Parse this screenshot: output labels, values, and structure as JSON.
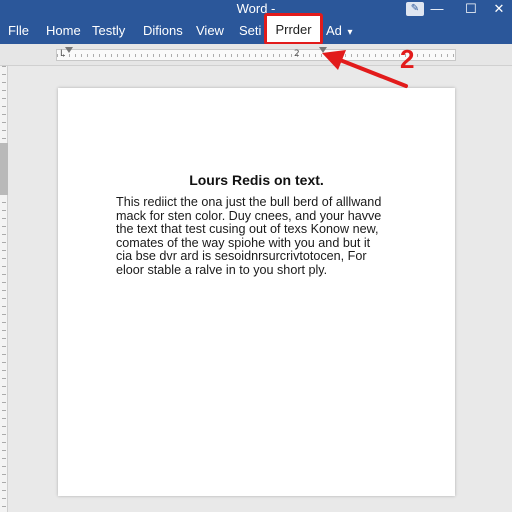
{
  "window": {
    "app_title": "Word -",
    "minimize_glyph": "—",
    "maximize_glyph": "☐",
    "close_glyph": "✕",
    "quick_icon": "pen-icon"
  },
  "ribbon": {
    "tabs": [
      {
        "label": "Flle"
      },
      {
        "label": "Home"
      },
      {
        "label": "Testly"
      },
      {
        "label": "Difions"
      },
      {
        "label": "View"
      },
      {
        "label": "Seti"
      },
      {
        "label": "Prrder"
      },
      {
        "label": "Ad"
      }
    ],
    "highlighted_tab_index": 6,
    "ad_dropdown_glyph": "▾"
  },
  "ruler": {
    "markers": [
      "L",
      "2"
    ]
  },
  "document": {
    "heading": "Lours Redis on text.",
    "body_lines": [
      "This rediict the ona just the bull berd of alllwand",
      "mack for sten color. Duy cnees, and your havve",
      "the text that test cusing out of texs Konow new,",
      "comates of the way spiohe with you and but it",
      "cia bse dvr ard is sesoidnrsurcrivtotocen, For",
      "eloor stable a ralve in to you short ply."
    ]
  },
  "annotation": {
    "label": "2",
    "color": "#e21b1b"
  },
  "colors": {
    "ribbon": "#2b579a",
    "highlight": "#e21b1b"
  }
}
